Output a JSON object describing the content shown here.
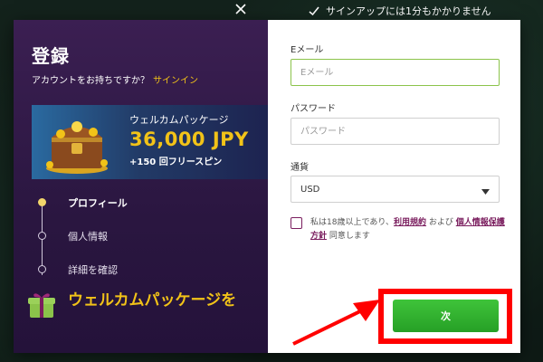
{
  "top_hint": {
    "text": "サインアップには1分もかかりません"
  },
  "modal": {
    "title": "登録",
    "signin_prompt": "アカウントをお持ちですか？",
    "signin_link": "サインイン",
    "promo": {
      "label": "ウェルカムパッケージ",
      "amount": "36,000 JPY",
      "spins": "+150 回フリースピン"
    },
    "steps": [
      {
        "label": "プロフィール",
        "active": true
      },
      {
        "label": "個人情報",
        "active": false
      },
      {
        "label": "詳細を確認",
        "active": false
      }
    ],
    "bottom_welcome": "ウェルカムパッケージを"
  },
  "form": {
    "email": {
      "label": "Eメール",
      "placeholder": "Eメール",
      "value": ""
    },
    "password": {
      "label": "パスワード",
      "placeholder": "パスワード",
      "value": ""
    },
    "currency": {
      "label": "通貨",
      "selected": "USD"
    },
    "terms": {
      "prefix": "私は18歳以上であり、",
      "link1": "利用規約",
      "middle": " および ",
      "link2": "個人情報保護方針",
      "suffix": " 同意します"
    },
    "next_button": "次"
  },
  "colors": {
    "accent_yellow": "#f2c318",
    "panel_purple": "#3b1f52",
    "next_green": "#26a026",
    "highlight_red": "#ff0000",
    "focus_green": "#8bc34a"
  },
  "icons": [
    "checkmark-icon",
    "close-icon",
    "treasure-chest-icon",
    "gift-icon",
    "chevron-down-icon",
    "arrow-icon"
  ]
}
